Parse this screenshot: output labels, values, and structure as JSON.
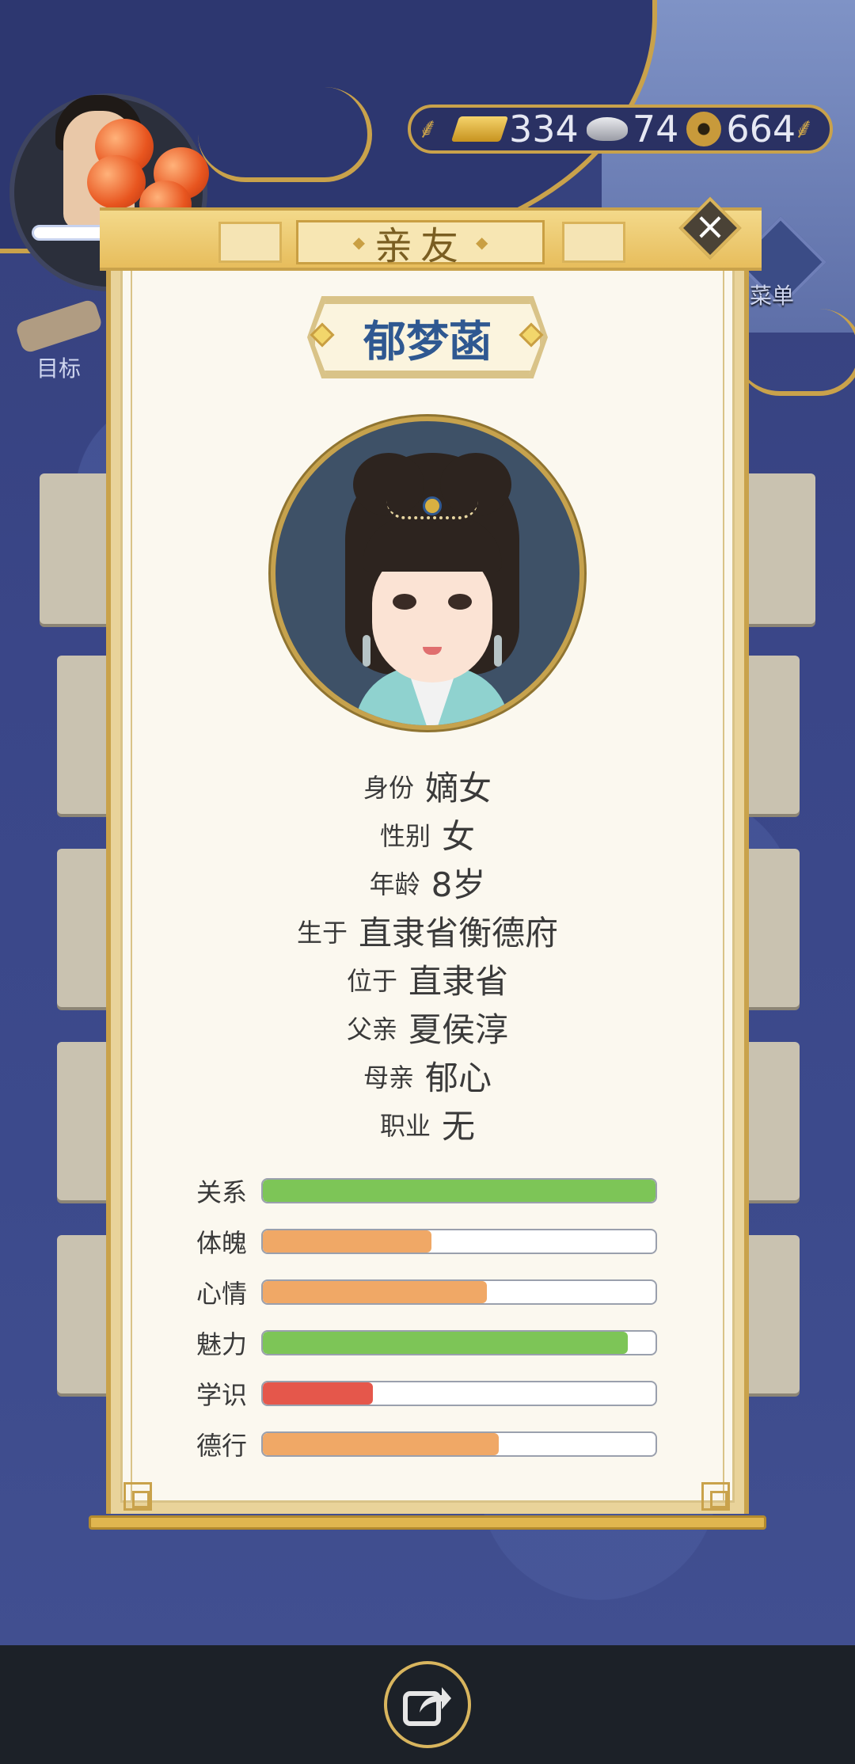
{
  "hud": {
    "resources": [
      {
        "icon": "gold-bar-icon",
        "value": "334"
      },
      {
        "icon": "silver-ingot-icon",
        "value": "74"
      },
      {
        "icon": "coin-icon",
        "value": "664"
      }
    ],
    "menu_label": "菜单",
    "goal_label": "目标"
  },
  "modal": {
    "title": "亲友",
    "name": "郁梦菡",
    "info": [
      {
        "label": "身份",
        "value": "嫡女"
      },
      {
        "label": "性别",
        "value": "女"
      },
      {
        "label": "年龄",
        "value": "8岁"
      },
      {
        "label": "生于",
        "value": "直隶省衡德府"
      },
      {
        "label": "位于",
        "value": "直隶省"
      },
      {
        "label": "父亲",
        "value": "夏侯淳"
      },
      {
        "label": "母亲",
        "value": "郁心"
      },
      {
        "label": "职业",
        "value": "无"
      }
    ],
    "stats": [
      {
        "label": "关系",
        "fraction": 1.0,
        "color": "#7dc557"
      },
      {
        "label": "体魄",
        "fraction": 0.43,
        "color": "#f0a866"
      },
      {
        "label": "心情",
        "fraction": 0.57,
        "color": "#f0a866"
      },
      {
        "label": "魅力",
        "fraction": 0.93,
        "color": "#7dc557"
      },
      {
        "label": "学识",
        "fraction": 0.28,
        "color": "#e5574b"
      },
      {
        "label": "德行",
        "fraction": 0.6,
        "color": "#f0a866"
      }
    ]
  },
  "bottom": {
    "share_icon": "share-icon"
  }
}
